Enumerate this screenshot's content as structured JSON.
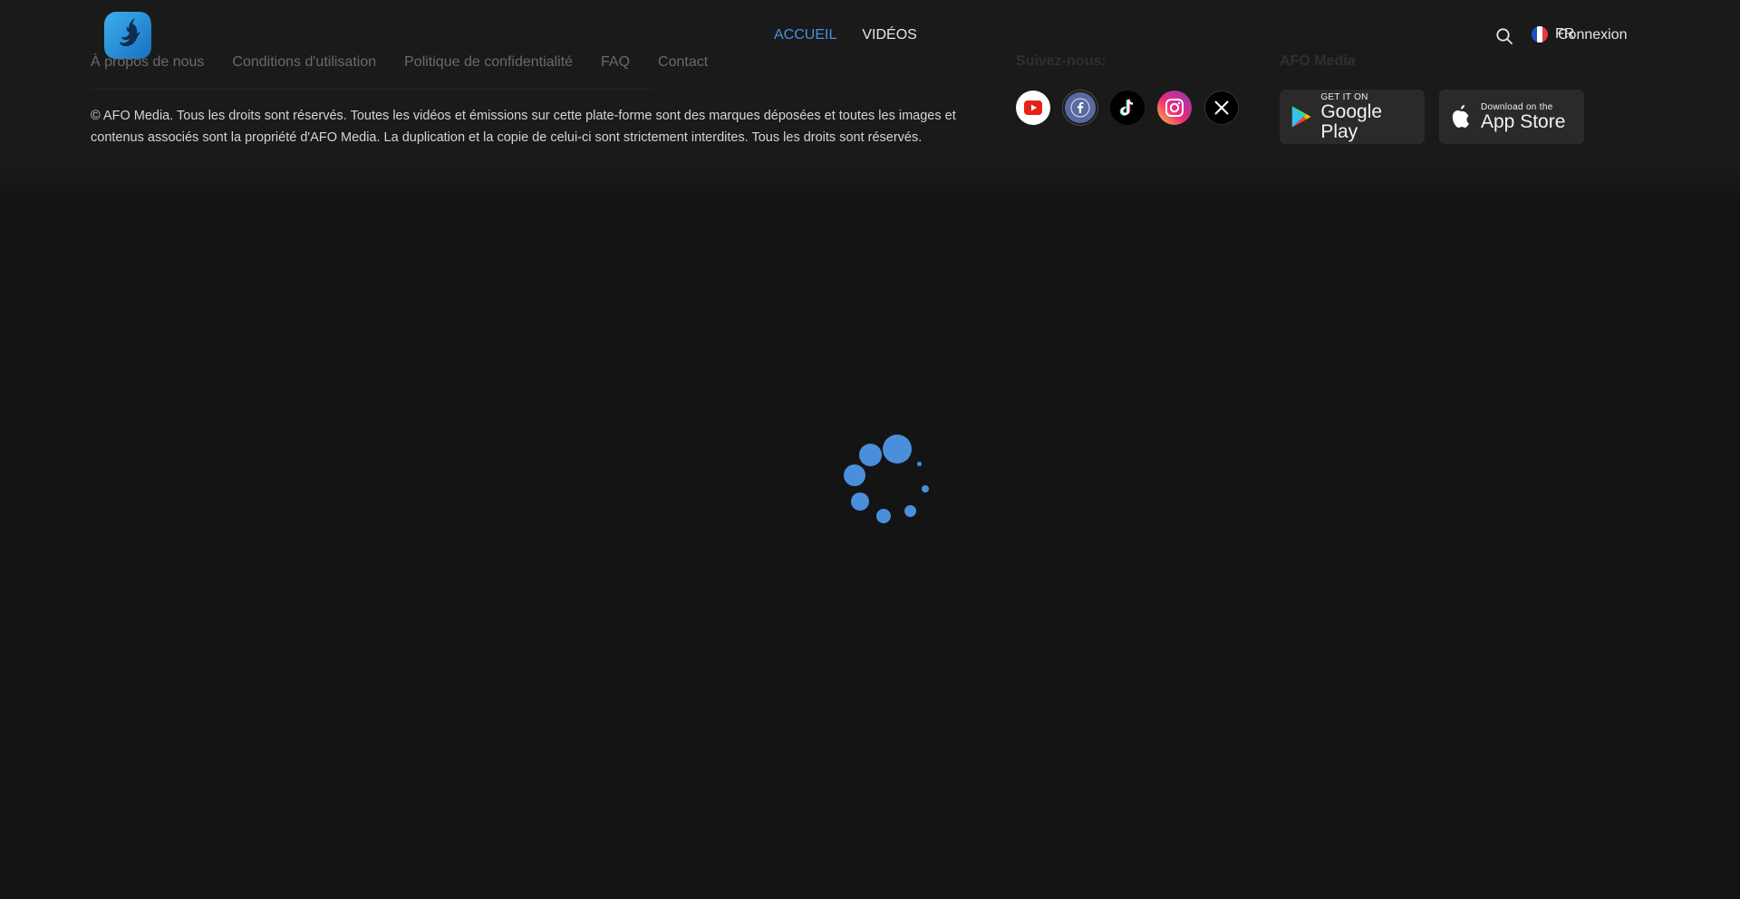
{
  "header": {
    "logo_name": "AFO Media logo",
    "nav": [
      {
        "label": "ACCUEIL",
        "active": true
      },
      {
        "label": "VIDÉOS",
        "active": false
      }
    ],
    "search_icon": "search-icon",
    "language": "FR",
    "login_label": "Connexion"
  },
  "footer": {
    "links": [
      "À propos de nous",
      "Conditions d'utilisation",
      "Politique de confidentialité",
      "FAQ",
      "Contact"
    ],
    "copyright": "© AFO Media. Tous les droits sont réservés. Toutes les vidéos et émissions sur cette plate-forme sont des marques déposées et toutes les images et contenus associés sont la propriété d'AFO Media. La duplication et la copie de celui-ci sont strictement interdites. Tous les droits sont réservés.",
    "follow_title": "Suivez-nous:",
    "socials": [
      "youtube-icon",
      "facebook-icon",
      "tiktok-icon",
      "instagram-icon",
      "x-icon"
    ],
    "store_title": "AFO Media",
    "google_play": {
      "small": "GET IT ON",
      "big": "Google Play"
    },
    "app_store": {
      "small": "Download on the",
      "big": "App Store"
    }
  },
  "colors": {
    "background": "#141414",
    "accent": "#4a90e2",
    "spinner": "#4a8fdc"
  }
}
